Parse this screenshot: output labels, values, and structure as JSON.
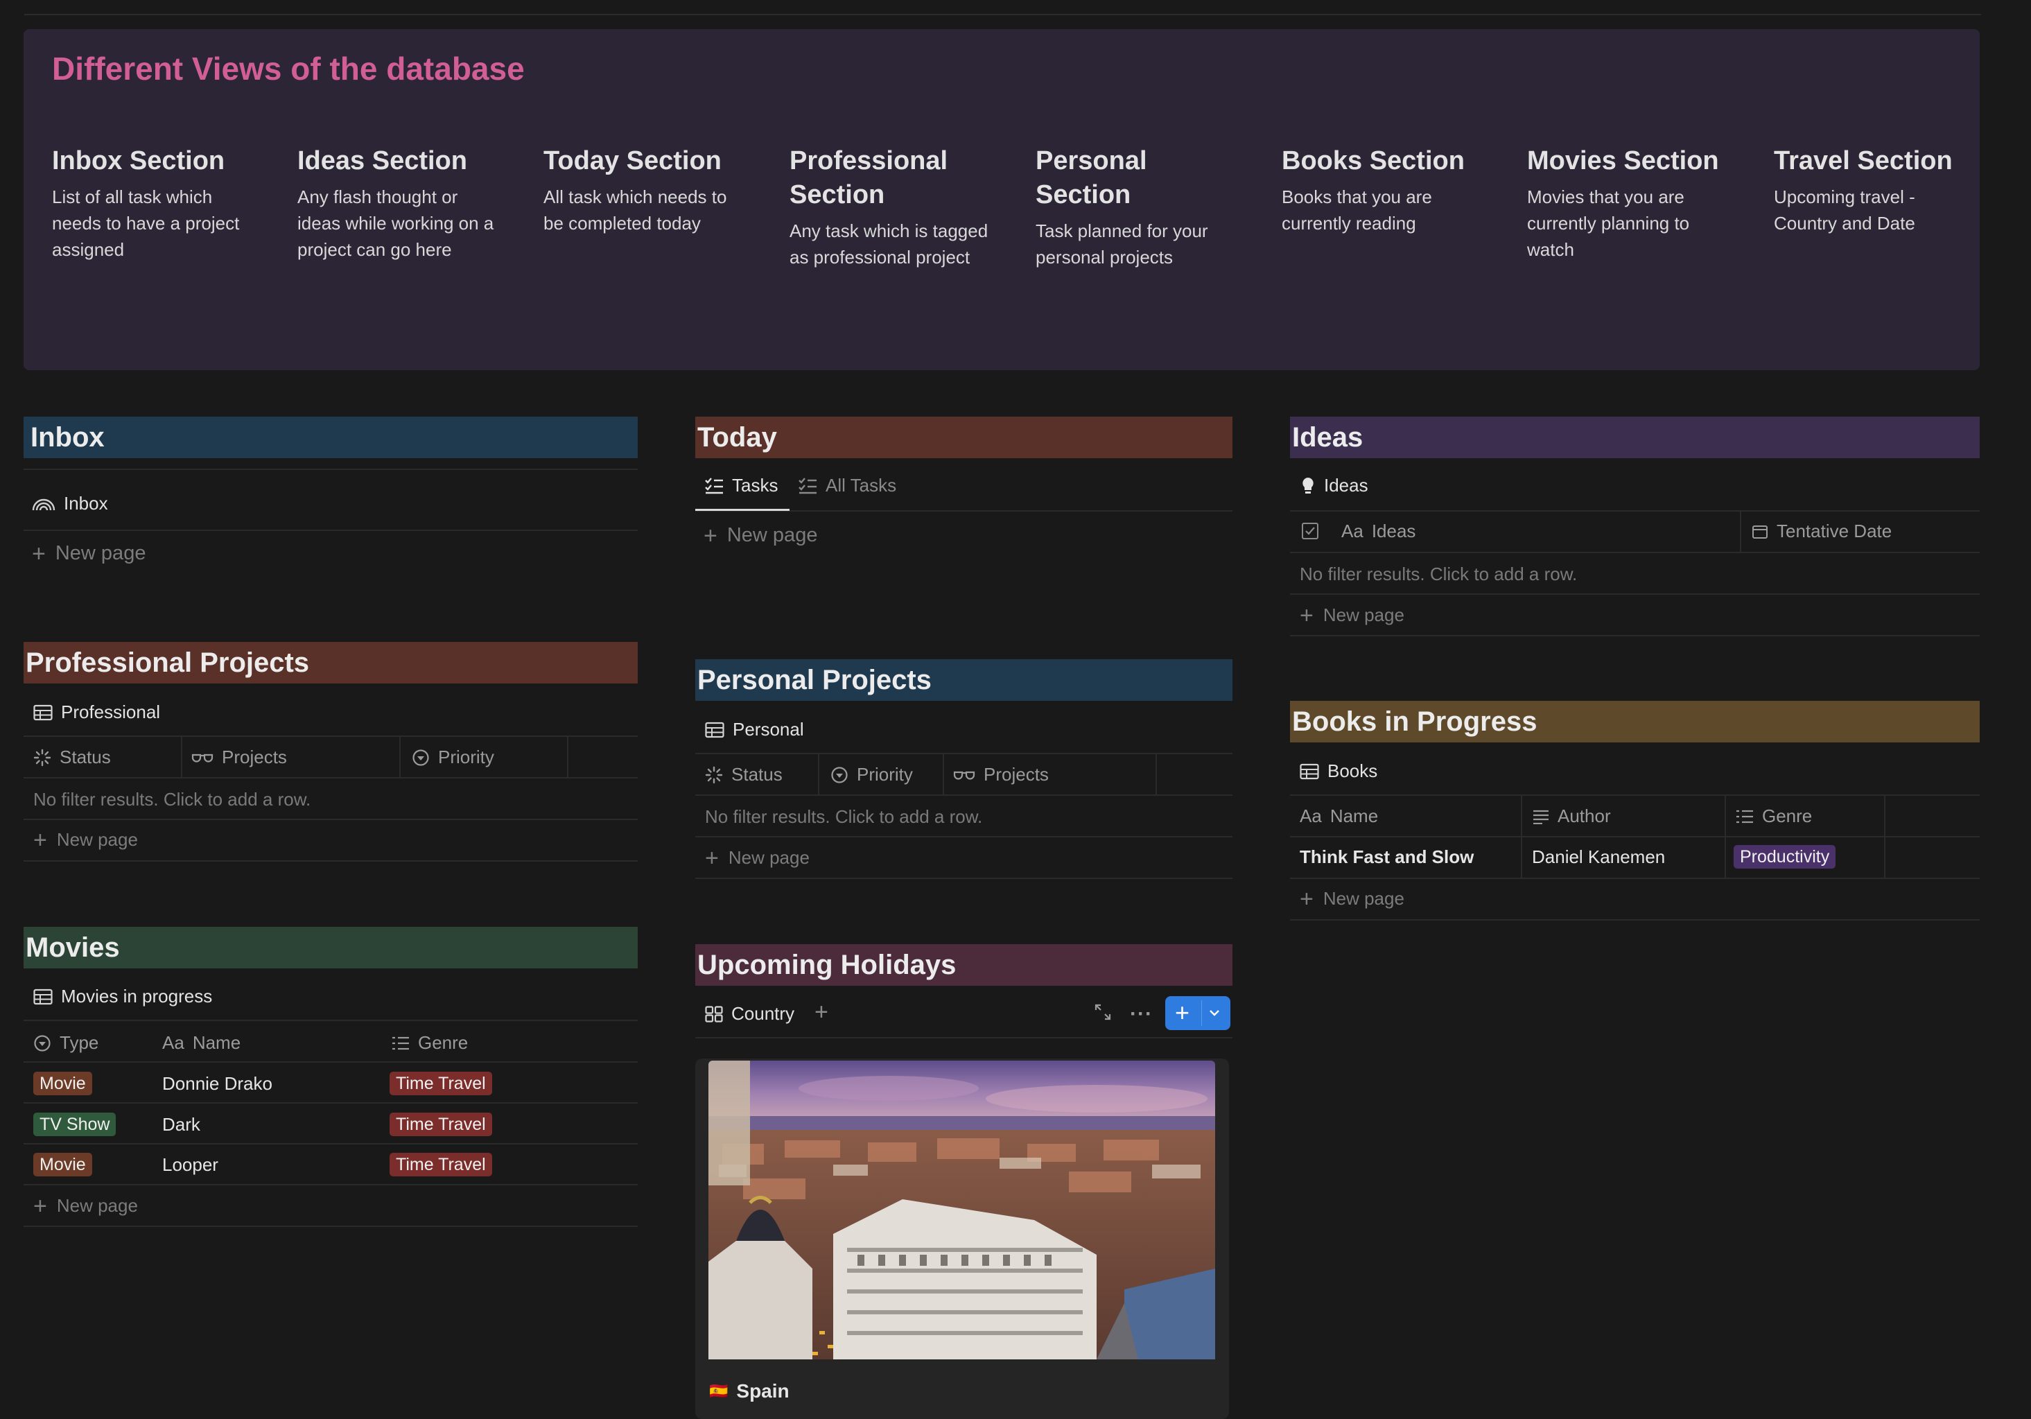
{
  "callout": {
    "title": "Different Views of the database",
    "sections": [
      {
        "title": "Inbox Section",
        "desc": "List of all task which needs to have a project assigned"
      },
      {
        "title": "Ideas Section",
        "desc": "Any flash thought or ideas while working on a project can go here"
      },
      {
        "title": "Today Section",
        "desc": "All task which needs to be completed today"
      },
      {
        "title": "Professional Section",
        "desc": "Any task which is tagged as professional project"
      },
      {
        "title": "Personal Section",
        "desc": "Task planned for your personal projects"
      },
      {
        "title": "Books Section",
        "desc": "Books that you are currently reading"
      },
      {
        "title": "Movies Section",
        "desc": "Movies that you are currently planning to watch"
      },
      {
        "title": "Travel Section",
        "desc": "Upcoming travel - Country and Date"
      }
    ]
  },
  "colors": {
    "inbox_header": "#1f3a4f",
    "today_header": "#5a3128",
    "ideas_header": "#3b2e4f",
    "professional_header": "#5a3128",
    "personal_header": "#1f3a4f",
    "books_header": "#5e4a2a",
    "movies_header": "#2c4435",
    "holidays_header": "#4c2b3b",
    "tag_movie": "#6b3b27",
    "tag_tvshow": "#2f5b3c",
    "tag_time_travel": "#7a2d2a",
    "tag_productivity": "#4b3169",
    "accent_blue": "#2e7ce0"
  },
  "inbox": {
    "header": "Inbox",
    "view": "Inbox",
    "view_icon": "rainbow-icon",
    "new_page": "New page"
  },
  "today": {
    "header": "Today",
    "tabs": [
      "Tasks",
      "All Tasks"
    ],
    "new_page": "New page"
  },
  "ideas": {
    "header": "Ideas",
    "view": "Ideas",
    "columns": [
      "Ideas",
      "Tentative Date"
    ],
    "empty": "No filter results. Click to add a row.",
    "new_page": "New page"
  },
  "professional": {
    "header": "Professional Projects",
    "view": "Professional",
    "columns": [
      "Status",
      "Projects",
      "Priority"
    ],
    "empty": "No filter results. Click to add a row.",
    "new_page": "New page"
  },
  "personal": {
    "header": "Personal Projects",
    "view": "Personal",
    "columns": [
      "Status",
      "Priority",
      "Projects"
    ],
    "empty": "No filter results. Click to add a row.",
    "new_page": "New page"
  },
  "books": {
    "header": "Books in Progress",
    "view": "Books",
    "columns": [
      "Name",
      "Author",
      "Genre"
    ],
    "rows": [
      {
        "name": "Think Fast and Slow",
        "author": "Daniel Kanemen",
        "genre": "Productivity"
      }
    ],
    "new_page": "New page"
  },
  "movies": {
    "header": "Movies",
    "view": "Movies in progress",
    "columns": [
      "Type",
      "Name",
      "Genre"
    ],
    "rows": [
      {
        "type": "Movie",
        "name": "Donnie Drako",
        "genre": "Time Travel"
      },
      {
        "type": "TV Show",
        "name": "Dark",
        "genre": "Time Travel"
      },
      {
        "type": "Movie",
        "name": "Looper",
        "genre": "Time Travel"
      }
    ],
    "new_page": "New page"
  },
  "holidays": {
    "header": "Upcoming Holidays",
    "view": "Country",
    "card_title": "Spain",
    "card_flag": "🇪🇸"
  },
  "aa_glyph": "Aa"
}
